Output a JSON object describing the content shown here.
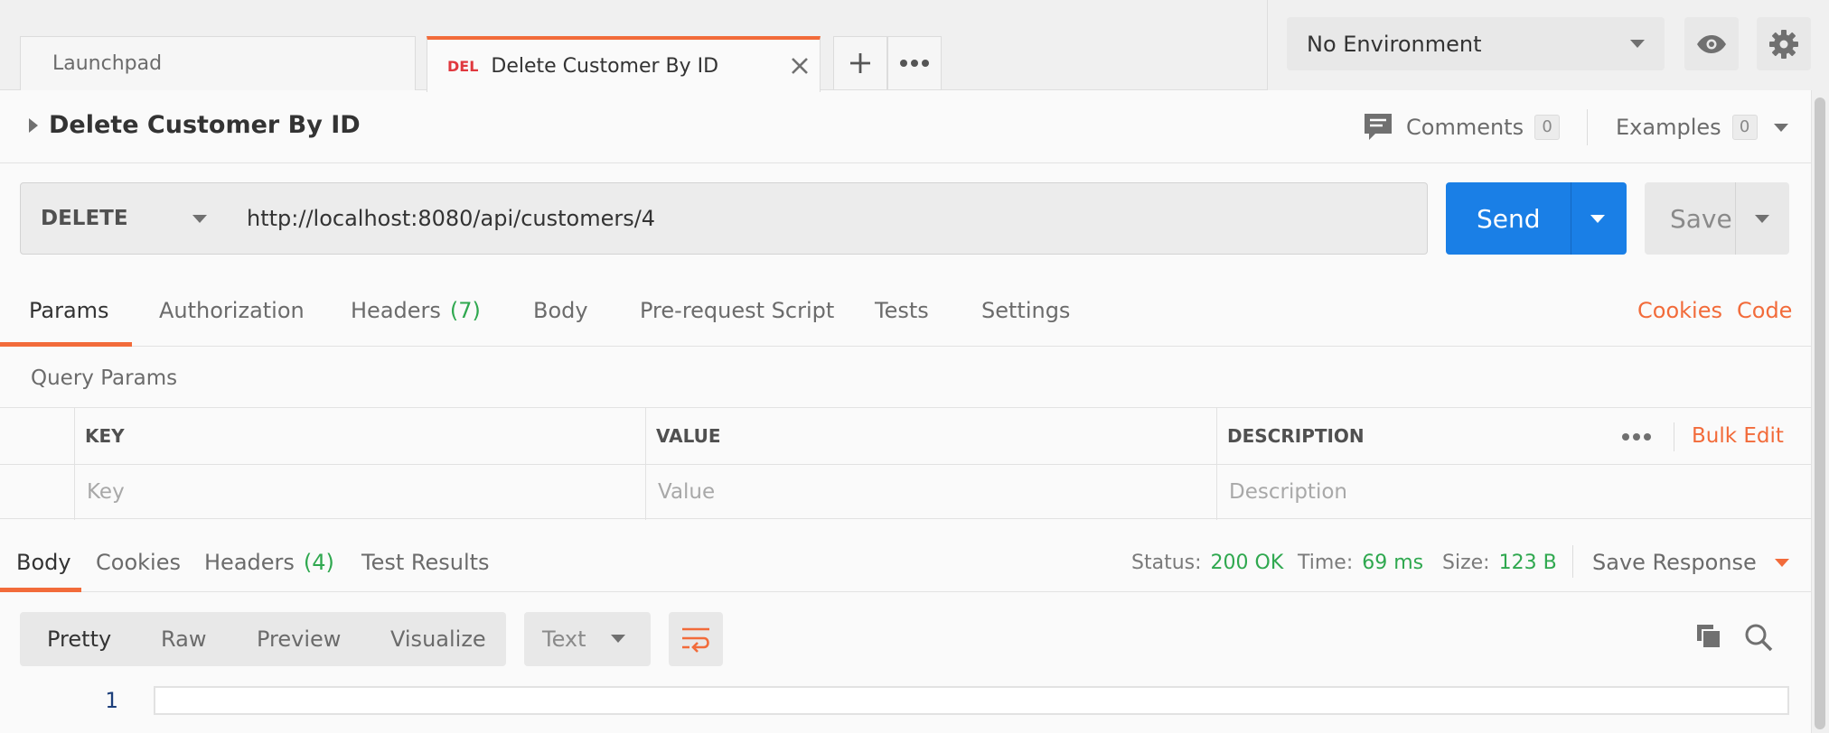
{
  "tabs": [
    {
      "label": "Launchpad"
    },
    {
      "method_badge": "DEL",
      "label": "Delete Customer By ID"
    }
  ],
  "environment": {
    "selected": "No Environment"
  },
  "request": {
    "title": "Delete Customer By ID",
    "comments_label": "Comments",
    "comments_count": "0",
    "examples_label": "Examples",
    "examples_count": "0",
    "method": "DELETE",
    "url": "http://localhost:8080/api/customers/4",
    "send_label": "Send",
    "save_label": "Save"
  },
  "request_tabs": {
    "params": "Params",
    "authorization": "Authorization",
    "headers": "Headers",
    "headers_count": "(7)",
    "body": "Body",
    "prerequest": "Pre-request Script",
    "tests": "Tests",
    "settings": "Settings",
    "cookies_link": "Cookies",
    "code_link": "Code"
  },
  "query_params": {
    "title": "Query Params",
    "columns": [
      "KEY",
      "VALUE",
      "DESCRIPTION"
    ],
    "bulk_edit": "Bulk Edit",
    "placeholders": {
      "key": "Key",
      "value": "Value",
      "description": "Description"
    }
  },
  "response": {
    "tabs": {
      "body": "Body",
      "cookies": "Cookies",
      "headers": "Headers",
      "headers_count": "(4)",
      "test_results": "Test Results"
    },
    "status_label": "Status:",
    "status_value": "200 OK",
    "time_label": "Time:",
    "time_value": "69 ms",
    "size_label": "Size:",
    "size_value": "123 B",
    "save_response": "Save Response",
    "view_modes": [
      "Pretty",
      "Raw",
      "Preview",
      "Visualize"
    ],
    "format": "Text",
    "line_number": "1"
  },
  "colors": {
    "accent": "#f26b3a",
    "send": "#1a7fe6",
    "success": "#2fa84f",
    "delete_method": "#e0383e"
  }
}
